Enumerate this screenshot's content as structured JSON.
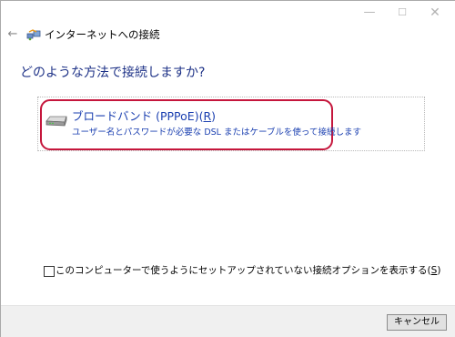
{
  "window": {
    "controls": {
      "minimize": "—",
      "maximize": "☐",
      "close": "✕"
    }
  },
  "header": {
    "back_glyph": "←",
    "title": "インターネットへの接続",
    "icon": "network-connection-icon"
  },
  "main": {
    "question": "どのような方法で接続しますか?",
    "options": [
      {
        "title_prefix": "ブロードバンド (PPPoE)(",
        "title_access_key": "R",
        "title_suffix": ")",
        "description": "ユーザー名とパスワードが必要な DSL またはケーブルを使って接続します",
        "icon": "modem-icon"
      }
    ]
  },
  "show_options_checkbox": {
    "checked": false,
    "label_prefix": "このコンピューターで使うようにセットアップされていない接続オプションを表示する(",
    "label_access_key": "S",
    "label_suffix": ")"
  },
  "footer": {
    "cancel_label": "キャンセル"
  },
  "colors": {
    "accent_blue": "#1a3fb0",
    "heading_blue": "#1e3287",
    "highlight_red": "#c5163c"
  }
}
